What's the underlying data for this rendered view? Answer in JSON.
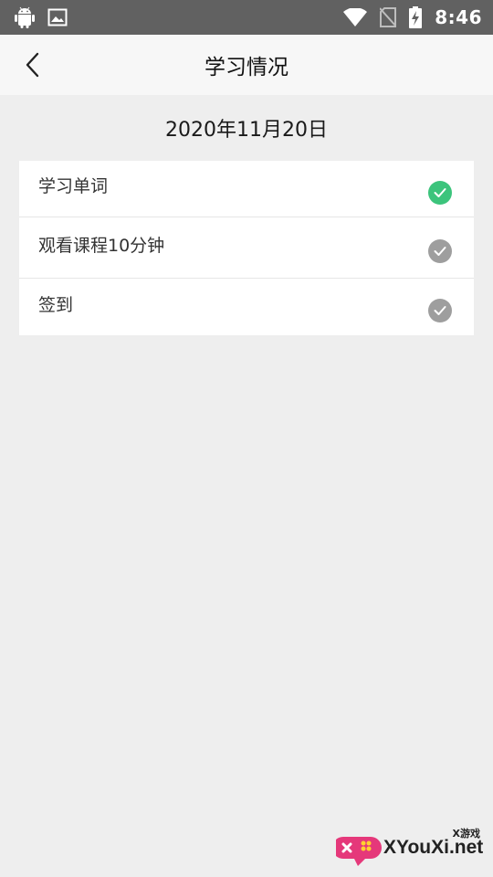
{
  "status_bar": {
    "time": "8:46",
    "icons": [
      "android-icon",
      "image-icon",
      "wifi-icon",
      "no-sim-icon",
      "battery-charging-icon"
    ]
  },
  "app_bar": {
    "title": "学习情况",
    "back_icon": "chevron-left-icon"
  },
  "date": "2020年11月20日",
  "tasks": [
    {
      "label": "学习单词",
      "done": true
    },
    {
      "label": "观看课程10分钟",
      "done": false
    },
    {
      "label": "签到",
      "done": false
    }
  ],
  "colors": {
    "status_bar": "#616161",
    "app_bar": "#f7f7f7",
    "background": "#eeeeee",
    "check_done": "#3cc47c",
    "check_pending": "#9e9e9e"
  },
  "watermark": {
    "text": "XYouXi.net",
    "sub": "X游戏"
  }
}
